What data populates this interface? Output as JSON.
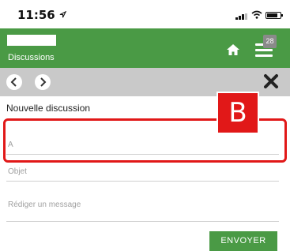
{
  "status_bar": {
    "time": "11:56"
  },
  "header": {
    "title": "Discussions",
    "badge_count": "28"
  },
  "form": {
    "section_title": "Nouvelle discussion",
    "recipient_placeholder": "A",
    "subject_placeholder": "Objet",
    "message_placeholder": "Rédiger un message",
    "send_label": "ENVOYER"
  },
  "annotation": {
    "label": "B"
  },
  "colors": {
    "header_green": "#4a9a45",
    "annotation_red": "#e11818",
    "nav_gray": "#c9c9c9"
  },
  "icons": [
    "location-arrow-icon",
    "signal-icon",
    "wifi-icon",
    "battery-icon",
    "home-icon",
    "menu-icon",
    "chevron-left-icon",
    "chevron-right-icon",
    "close-icon"
  ]
}
